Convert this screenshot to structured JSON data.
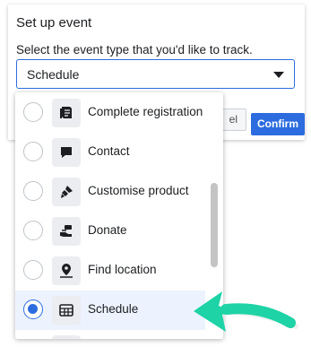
{
  "dialog": {
    "title": "Set up event",
    "subtitle": "Select the event type that you'd like to track.",
    "select_value": "Schedule",
    "cancel_label": "el",
    "confirm_label": "Confirm"
  },
  "dropdown": {
    "options": [
      {
        "label": "Complete registration",
        "icon": "registration-icon",
        "selected": false
      },
      {
        "label": "Contact",
        "icon": "chat-bubble-icon",
        "selected": false
      },
      {
        "label": "Customise product",
        "icon": "paintbrush-icon",
        "selected": false
      },
      {
        "label": "Donate",
        "icon": "donate-hand-icon",
        "selected": false
      },
      {
        "label": "Find location",
        "icon": "map-pin-icon",
        "selected": false
      },
      {
        "label": "Schedule",
        "icon": "calendar-grid-icon",
        "selected": true
      }
    ]
  },
  "colors": {
    "accent": "#2d6cdf",
    "selected_row": "#ecf3ff",
    "arrow": "#1ed3a6"
  }
}
